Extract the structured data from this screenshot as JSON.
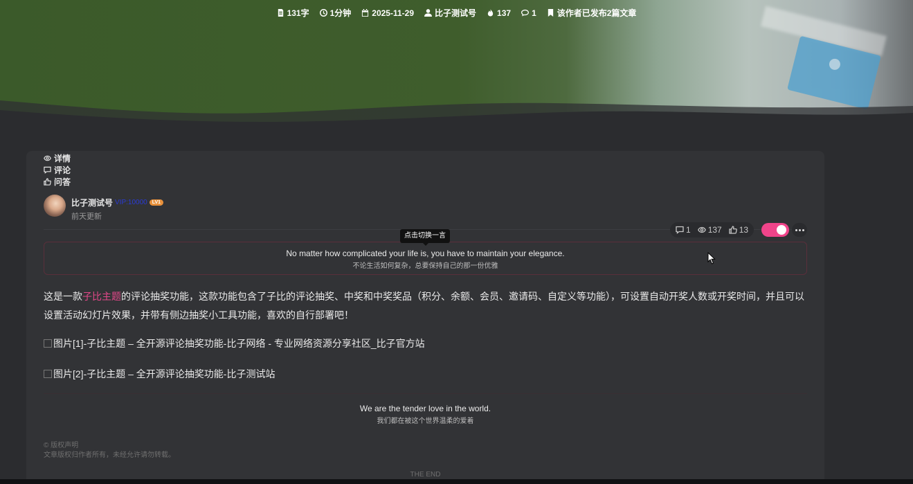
{
  "meta": {
    "word_count": "131字",
    "read_time": "1分钟",
    "date": "2025-11-29",
    "author": "比子测试号",
    "hot": "137",
    "comments": "1",
    "articles": "该作者已发布2篇文章"
  },
  "tabs": [
    {
      "label": "详情",
      "icon": "eye-icon"
    },
    {
      "label": "评论",
      "icon": "comment-icon"
    },
    {
      "label": "问答",
      "icon": "thumb-icon"
    }
  ],
  "author_block": {
    "name": "比子测试号",
    "vip_text": "VIP:10000",
    "level": "LV1",
    "updated": "前天更新"
  },
  "stats": {
    "comments": "1",
    "views": "137",
    "likes": "13"
  },
  "tooltip": "点击切换一言",
  "quote": {
    "en": "No matter how complicated your life is, you have to maintain your elegance.",
    "cn": "不论生活如何复杂，总要保持自己的那一份优雅"
  },
  "article": {
    "prefix": "这是一款",
    "link": "子比主题",
    "rest": "的评论抽奖功能，这款功能包含了子比的评论抽奖、中奖和中奖奖品（积分、余额、会员、邀请码、自定义等功能），可设置自动开奖人数或开奖时间，并且可以设置活动幻灯片效果，并带有侧边抽奖小工具功能，喜欢的自行部署吧！",
    "img1": "图片[1]-子比主题 – 全开源评论抽奖功能-比子网络 - 专业网络资源分享社区_比子官方站",
    "img2": "图片[2]-子比主题 – 全开源评论抽奖功能-比子测试站"
  },
  "end_quote": {
    "en": "We are the tender love in the world.",
    "cn": "我们都在被这个世界温柔的爱着"
  },
  "copyright": {
    "title": "© 版权声明",
    "text": "文章版权归作者所有，未经允许请勿转载。"
  },
  "the_end": "THE END",
  "colors": {
    "accent": "#e3488a",
    "toggle": "#f0448a",
    "card_bg": "#323336",
    "page_bg": "#2b2c2f"
  }
}
